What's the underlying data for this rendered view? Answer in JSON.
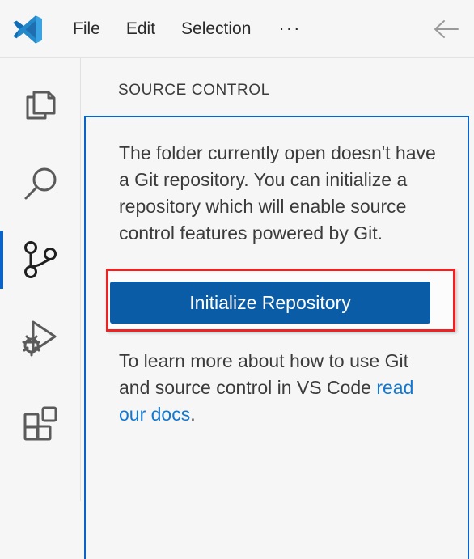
{
  "app": {
    "name": "Visual Studio Code",
    "logo_icon": "vscode-logo"
  },
  "menubar": {
    "items": [
      {
        "label": "File"
      },
      {
        "label": "Edit"
      },
      {
        "label": "Selection"
      },
      {
        "label": "···"
      }
    ],
    "back_icon": "arrow-left-icon"
  },
  "activitybar": {
    "items": [
      {
        "name": "explorer",
        "icon": "files-icon",
        "active": false
      },
      {
        "name": "search",
        "icon": "search-icon",
        "active": false
      },
      {
        "name": "source-control",
        "icon": "source-control-icon",
        "active": true
      },
      {
        "name": "run-and-debug",
        "icon": "run-and-debug-icon",
        "active": false
      },
      {
        "name": "extensions",
        "icon": "extensions-icon",
        "active": false
      }
    ]
  },
  "sidebar": {
    "title": "SOURCE CONTROL",
    "welcome": {
      "paragraph1": "The folder currently open doesn't have a Git repository. You can initialize a repository which will enable source control features powered by Git.",
      "button_label": "Initialize Repository",
      "paragraph2_prefix": "To learn more about how to use Git and source control in VS Code ",
      "link_text": "read our docs",
      "paragraph2_suffix": "."
    }
  },
  "annotation": {
    "highlight_color": "#ee2222",
    "target": "initialize-repository-button"
  },
  "colors": {
    "background": "#f6f6f6",
    "accent": "#0a63c9",
    "button": "#0b5ca6",
    "link": "#1177d1",
    "text": "#3b3b3b",
    "icon": "#5a5a5a",
    "icon_active": "#1f1f1f"
  }
}
